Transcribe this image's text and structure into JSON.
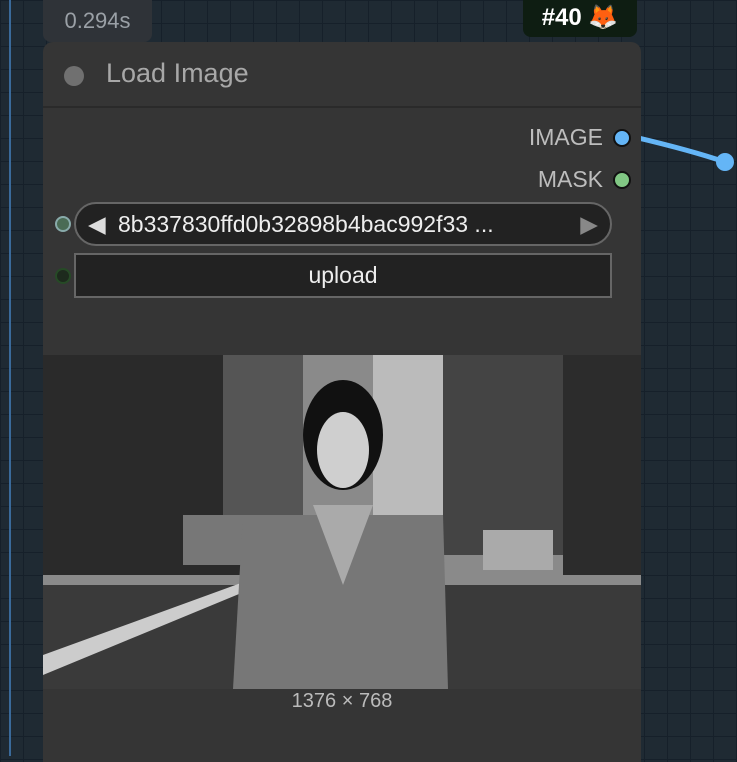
{
  "timing": "0.294s",
  "badge": {
    "label": "#40",
    "icon": "fox-icon"
  },
  "node": {
    "title": "Load Image",
    "outputs": [
      {
        "label": "IMAGE",
        "color": "#64b5f6"
      },
      {
        "label": "MASK",
        "color": "#81c784"
      }
    ],
    "image_widget": {
      "value": "8b337830ffd0b32898b4bac992f33  ..."
    },
    "upload_label": "upload",
    "image_size": "1376 × 768"
  }
}
